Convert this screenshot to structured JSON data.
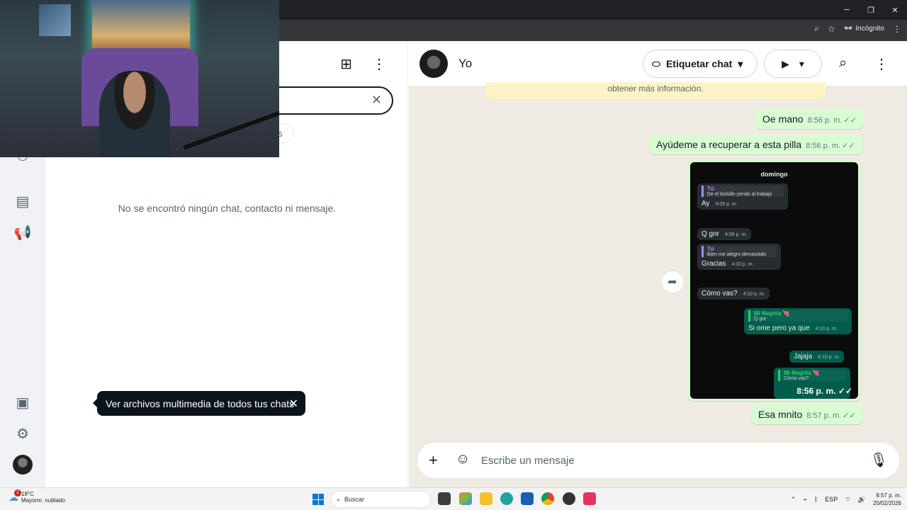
{
  "browser": {
    "incognito_label": "Incógnito",
    "window_controls": [
      "─",
      "❐",
      "✕"
    ]
  },
  "nav_rail": {
    "icons": [
      "communities-icon",
      "store-icon",
      "channels-icon",
      "media-icon",
      "settings-icon",
      "profile-avatar"
    ]
  },
  "chat_list": {
    "filter_chip_label": "s",
    "no_results": "No se encontró ningún chat, contacto ni mensaje.",
    "tooltip": "Ver archivos multimedia de todos tus chats"
  },
  "chat": {
    "contact_name": "Yo",
    "tag_button": "Etiquetar chat",
    "banner_text": "obtener más información.",
    "messages": [
      {
        "text": "Oe mano",
        "time": "8:56 p. m."
      },
      {
        "text": "Ayúdeme a recuperar a esta pilla",
        "time": "8:56 p. m."
      },
      {
        "text": "Esa mnito",
        "time": "8:57 p. m."
      }
    ],
    "image_message_time": "8:56 p. m.",
    "screenshot": {
      "day": "domingo",
      "bubbles": [
        {
          "quote_name": "Tú",
          "quote_text": "De el bolsillo yendo al trabajo",
          "text": "Ay",
          "time": "4:09 p. m."
        },
        {
          "text": "Q gnr",
          "time": "4:09 p. m."
        },
        {
          "quote_name": "Tú",
          "quote_text": "Bien me alegro demasiado",
          "text": "Gracias",
          "time": "4:10 p. m."
        },
        {
          "text": "Cómo vas?",
          "time": "4:10 p. m."
        },
        {
          "quote_name": "Mi Negrita 💘",
          "quote_text": "Q gnr",
          "text": "Si ome pero ya que",
          "time": "4:10 p. m."
        },
        {
          "text": "Jajaja",
          "time": "4:10 p. m."
        },
        {
          "quote_name": "Mi Negrita 💘",
          "quote_text": "Cómo vas?",
          "text": "",
          "time": ""
        }
      ]
    },
    "composer_placeholder": "Escribe un mensaje"
  },
  "taskbar": {
    "temperature": "18°C",
    "weather": "Mayorm. nublado",
    "weather_badge": "1",
    "search_label": "Buscar",
    "lang": "ESP",
    "time": "8:57 p. m.",
    "date": "20/02/2026"
  },
  "colors": {
    "outgoing_bubble": "#d9fdd3",
    "chat_background": "#efeae2",
    "taskbar": "#f3f3f3"
  }
}
